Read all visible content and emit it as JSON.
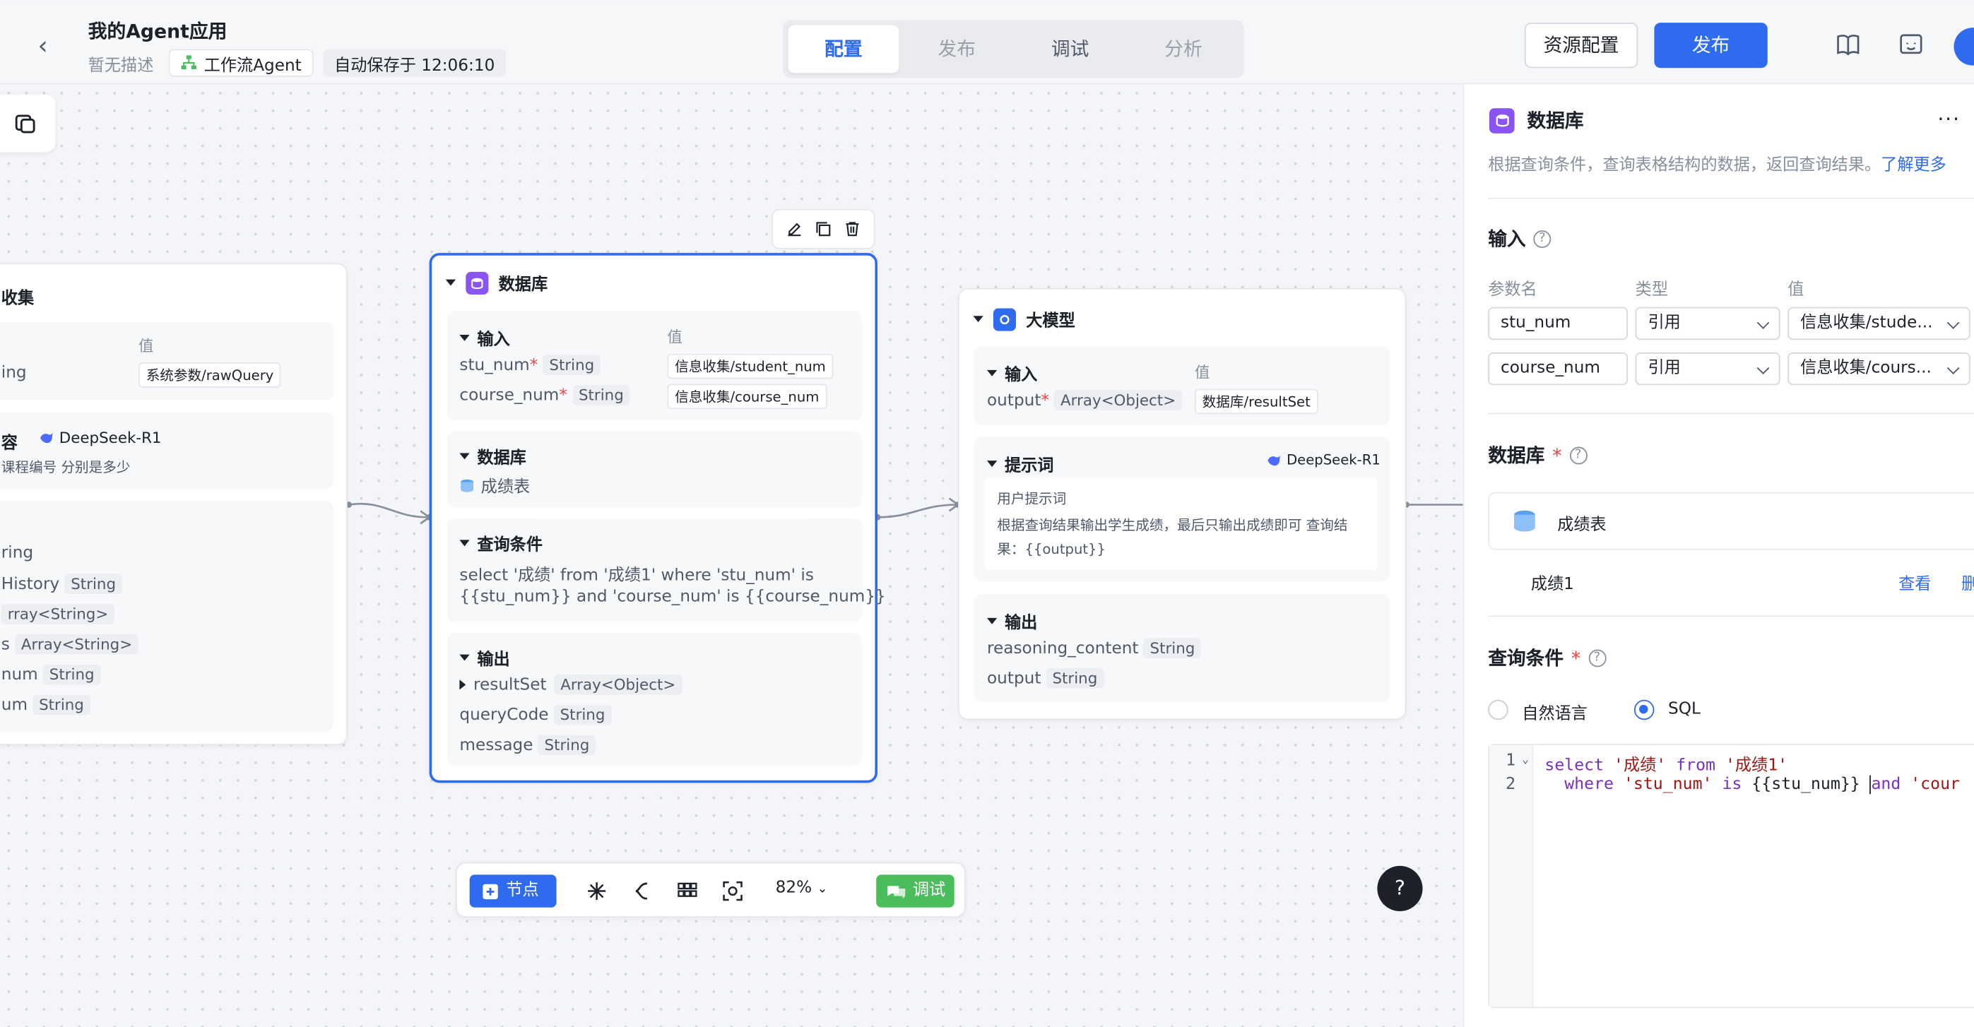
{
  "header": {
    "app_title": "我的Agent应用",
    "desc": "暂无描述",
    "type_tag": "工作流Agent",
    "autosave": "自动保存于 12:06:10",
    "tabs": [
      "配置",
      "发布",
      "调试",
      "分析"
    ],
    "active_tab": "配置",
    "resource_btn": "资源配置",
    "publish_btn": "发布"
  },
  "left_node": {
    "title": "收集",
    "value_header": "值",
    "input_type_partial": "ing",
    "input_value": "系统参数/rawQuery",
    "model_partial_label": "容",
    "model": "DeepSeek-R1",
    "prompt_partial": "课程编号 分别是多少",
    "outputs": [
      {
        "name": "ring",
        "type": ""
      },
      {
        "name": "History",
        "type": "String"
      },
      {
        "name": "rray<String>",
        "type": ""
      },
      {
        "name": "s",
        "type": "Array<String>"
      },
      {
        "name": "num",
        "type": "String"
      },
      {
        "name": "um",
        "type": "String"
      }
    ]
  },
  "db_node": {
    "title": "数据库",
    "input_title": "输入",
    "value_header": "值",
    "inputs": [
      {
        "name": "stu_num",
        "type": "String",
        "value": "信息收集/student_num"
      },
      {
        "name": "course_num",
        "type": "String",
        "value": "信息收集/course_num"
      }
    ],
    "db_title": "数据库",
    "db_table": "成绩表",
    "query_title": "查询条件",
    "query_line1": "select '成绩' from '成绩1' where 'stu_num' is",
    "query_line2": "{{stu_num}} and 'course_num' is {{course_num}}",
    "output_title": "输出",
    "outputs": [
      {
        "name": "resultSet",
        "type": "Array<Object>"
      },
      {
        "name": "queryCode",
        "type": "String"
      },
      {
        "name": "message",
        "type": "String"
      }
    ]
  },
  "llm_node": {
    "title": "大模型",
    "input_title": "输入",
    "value_header": "值",
    "input_name": "output",
    "input_type": "Array<Object>",
    "input_value": "数据库/resultSet",
    "prompt_title": "提示词",
    "model": "DeepSeek-R1",
    "user_prompt_label": "用户提示词",
    "prompt_line1": "根据查询结果输出学生成绩，最后只输出成绩即可 查询结",
    "prompt_line2": "果：{{output}}",
    "output_title": "输出",
    "outputs": [
      {
        "name": "reasoning_content",
        "type": "String"
      },
      {
        "name": "output",
        "type": "String"
      }
    ]
  },
  "bottom_bar": {
    "node_btn": "节点",
    "zoom": "82%",
    "debug_btn": "调试"
  },
  "help": "?",
  "panel": {
    "title": "数据库",
    "more": "···",
    "desc": "根据查询条件，查询表格结构的数据，返回查询结果。",
    "learn_more": "了解更多",
    "input_title": "输入",
    "col_name": "参数名",
    "col_type": "类型",
    "col_value": "值",
    "params": [
      {
        "name": "stu_num",
        "type": "引用",
        "value": "信息收集/stude..."
      },
      {
        "name": "course_num",
        "type": "引用",
        "value": "信息收集/cours..."
      }
    ],
    "db_title": "数据库",
    "db_table": "成绩表",
    "db_field": "成绩1",
    "view": "查看",
    "delete_partial": "删",
    "query_title": "查询条件",
    "mode_nl": "自然语言",
    "mode_sql": "SQL",
    "code_lines": [
      "1",
      "2"
    ]
  },
  "colors": {
    "primary": "#2f6bef",
    "db_icon": "#8a54f2",
    "debug_green": "#4cbd5c"
  }
}
